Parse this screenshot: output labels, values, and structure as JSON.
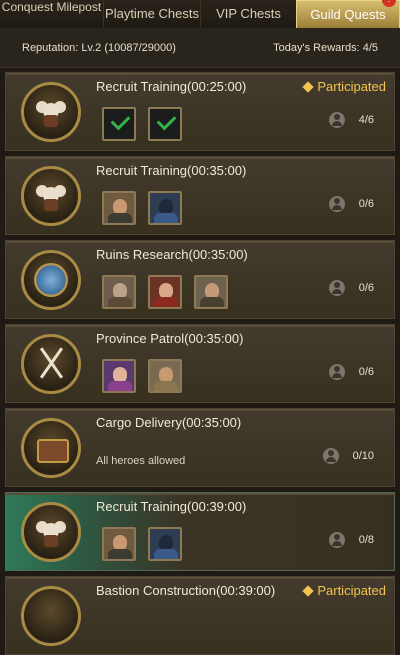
{
  "tabs": [
    {
      "label": "Conquest Milepost",
      "active": false
    },
    {
      "label": "Playtime Chests",
      "active": false
    },
    {
      "label": "VIP Chests",
      "active": false
    },
    {
      "label": "Guild Quests",
      "active": true,
      "badge": "!"
    }
  ],
  "info": {
    "reputation": "Reputation: Lv.2 (10087/29000)",
    "rewards": "Today's Rewards: 4/5"
  },
  "quests": [
    {
      "title": "Recruit Training(00:25:00)",
      "status": "Participated",
      "count": "4/6",
      "emblem": "recruit-emblem-icon",
      "heroes": [
        "checked-slot",
        "checked-slot"
      ]
    },
    {
      "title": "Recruit Training(00:35:00)",
      "status": "",
      "count": "0/6",
      "emblem": "recruit-emblem-icon",
      "heroes": [
        "hero-portrait",
        "hero-portrait"
      ]
    },
    {
      "title": "Ruins Research(00:35:00)",
      "status": "",
      "count": "0/6",
      "emblem": "gear-emblem-icon",
      "heroes": [
        "hero-portrait",
        "hero-portrait",
        "hero-portrait"
      ]
    },
    {
      "title": "Province Patrol(00:35:00)",
      "status": "",
      "count": "0/6",
      "emblem": "swords-emblem-icon",
      "heroes": [
        "hero-portrait",
        "hero-portrait"
      ]
    },
    {
      "title": "Cargo Delivery(00:35:00)",
      "status": "",
      "count": "0/10",
      "emblem": "cargo-emblem-icon",
      "note": "All heroes allowed",
      "heroes": []
    },
    {
      "title": "Recruit Training(00:39:00)",
      "status": "",
      "count": "0/8",
      "emblem": "recruit-emblem-icon",
      "heroes": [
        "hero-portrait",
        "hero-portrait"
      ],
      "highlight": true
    },
    {
      "title": "Bastion Construction(00:39:00)",
      "status": "Participated",
      "count": "",
      "emblem": "bastion-emblem-icon",
      "heroes": []
    }
  ],
  "colors": {
    "accent": "#f4c451",
    "active_tab": "#c2a45a",
    "check": "#35b34a"
  }
}
